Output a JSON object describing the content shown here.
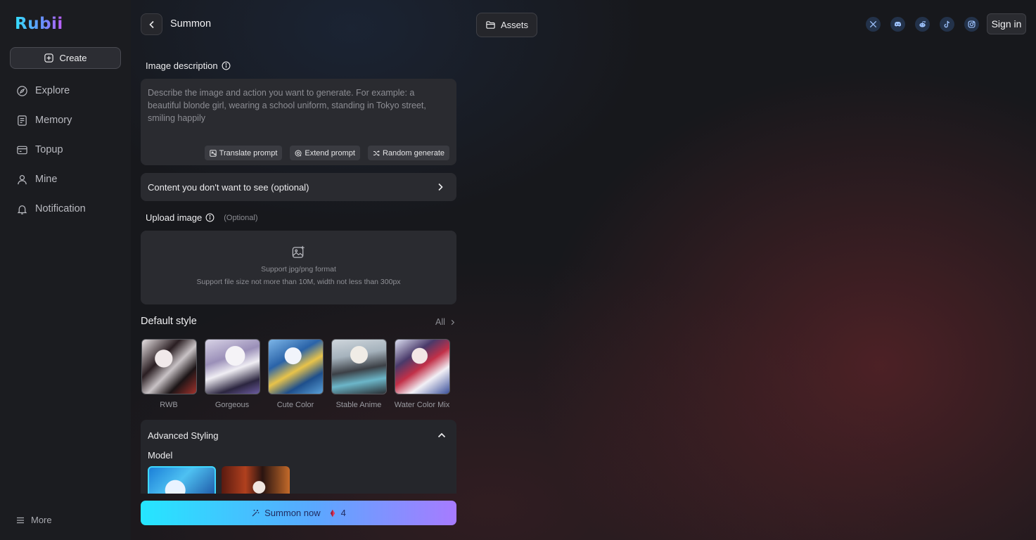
{
  "app": {
    "logo_text": "Rubii"
  },
  "sidebar": {
    "create_label": "Create",
    "items": [
      {
        "label": "Explore",
        "icon": "compass-icon"
      },
      {
        "label": "Memory",
        "icon": "memory-icon"
      },
      {
        "label": "Topup",
        "icon": "card-icon"
      },
      {
        "label": "Mine",
        "icon": "user-icon"
      },
      {
        "label": "Notification",
        "icon": "bell-icon"
      }
    ],
    "more_label": "More"
  },
  "header": {
    "title": "Summon",
    "assets_label": "Assets",
    "socials": [
      "x-icon",
      "discord-icon",
      "reddit-icon",
      "tiktok-icon",
      "instagram-icon"
    ],
    "signin_label": "Sign in"
  },
  "form": {
    "description_label": "Image description",
    "description_placeholder": "Describe the image and action you want to generate. For example: a beautiful blonde girl, wearing a school uniform, standing in Tokyo street, smiling happily",
    "tools": {
      "translate": "Translate prompt",
      "extend": "Extend prompt",
      "random": "Random generate"
    },
    "negative_label": "Content you don't want to see (optional)",
    "upload_label": "Upload image",
    "upload_optional": "(Optional)",
    "upload_line1": "Support jpg/png format",
    "upload_line2": "Support file size not more than 10M, width not less than 300px",
    "default_style_title": "Default style",
    "all_label": "All",
    "styles": [
      {
        "name": "RWB"
      },
      {
        "name": "Gorgeous"
      },
      {
        "name": "Cute Color"
      },
      {
        "name": "Stable Anime"
      },
      {
        "name": "Water Color Mix"
      }
    ],
    "advanced_title": "Advanced Styling",
    "model_label": "Model",
    "summon_label": "Summon now",
    "summon_cost": "4"
  },
  "colors": {
    "accent_start": "#25e6ff",
    "accent_end": "#a77bff",
    "panel": "#2a2b30"
  }
}
